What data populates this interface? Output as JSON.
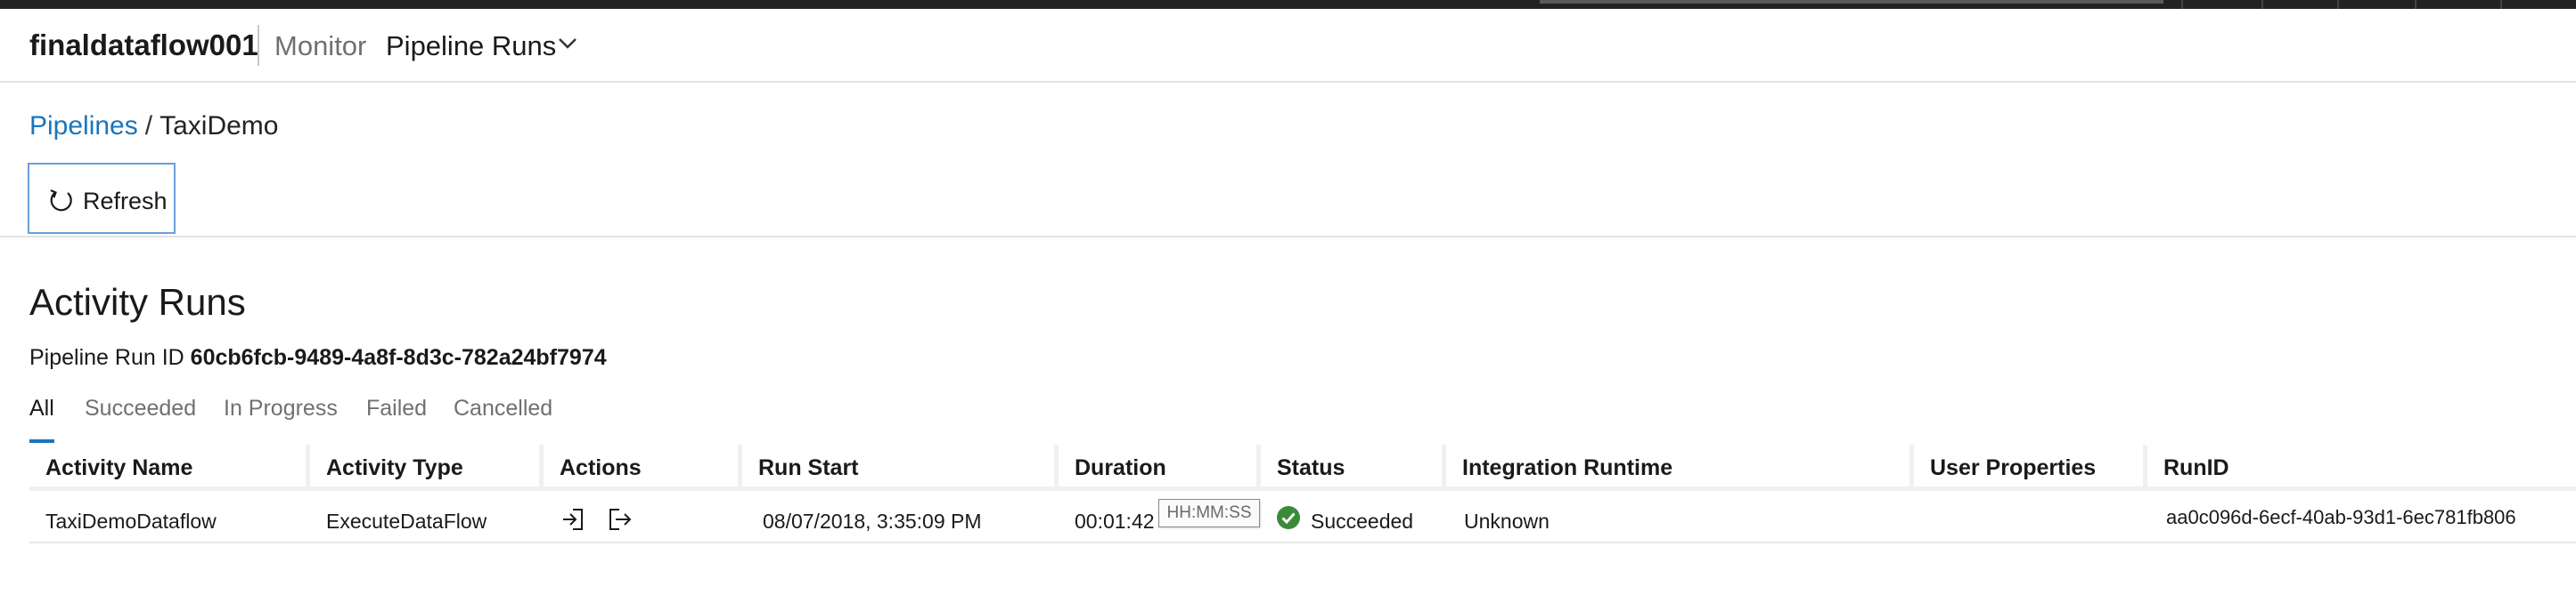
{
  "header": {
    "factory_name": "finaldataflow001",
    "section": "Monitor",
    "view": "Pipeline Runs"
  },
  "breadcrumb": {
    "root": "Pipelines",
    "separator": "/",
    "current": "TaxiDemo"
  },
  "toolbar": {
    "refresh_label": "Refresh"
  },
  "page": {
    "title": "Activity Runs",
    "run_id_label": "Pipeline Run ID",
    "run_id_value": "60cb6fcb-9489-4a8f-8d3c-782a24bf7974"
  },
  "tabs": [
    {
      "label": "All",
      "active": true
    },
    {
      "label": "Succeeded",
      "active": false
    },
    {
      "label": "In Progress",
      "active": false
    },
    {
      "label": "Failed",
      "active": false
    },
    {
      "label": "Cancelled",
      "active": false
    }
  ],
  "table": {
    "columns": [
      "Activity Name",
      "Activity Type",
      "Actions",
      "Run Start",
      "Duration",
      "Status",
      "Integration Runtime",
      "User Properties",
      "RunID"
    ],
    "rows": [
      {
        "activity_name": "TaxiDemoDataflow",
        "activity_type": "ExecuteDataFlow",
        "actions": [
          "input-icon",
          "output-icon"
        ],
        "run_start": "08/07/2018, 3:35:09 PM",
        "duration": "00:01:42",
        "duration_tooltip": "HH:MM:SS",
        "status": "Succeeded",
        "status_icon": "check-circle-icon",
        "integration_runtime": "Unknown",
        "user_properties": "",
        "run_id": "aa0c096d-6ecf-40ab-93d1-6ec781fb806"
      }
    ]
  },
  "colors": {
    "accent": "#1b75bb",
    "success": "#3a8a3a",
    "topbar": "#222222"
  }
}
